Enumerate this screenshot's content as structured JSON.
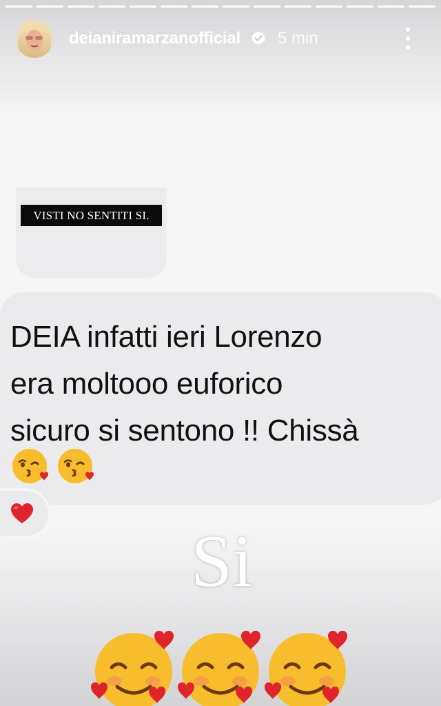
{
  "progress": {
    "segments": 14,
    "current": 14
  },
  "header": {
    "username": "deianiramarzanofficial",
    "time": "5 min",
    "avatar_icon": "avatar-photo",
    "verified_icon": "verified-badge-icon",
    "more_icon": "more-vertical-icon"
  },
  "quote": {
    "label": "VISTI NO SENTITI SI."
  },
  "message": {
    "lines": [
      "DEIA infatti ieri Lorenzo",
      "era moltooo euforico",
      "sicuro si sentono !! Chissà"
    ],
    "emoji": "kissing-face-with-heart-icon",
    "emoji_count": 2,
    "reaction": "red-heart-icon"
  },
  "overlay": {
    "text": "Si",
    "emoji": "smiling-face-with-hearts-icon",
    "emoji_count": 3
  },
  "colors": {
    "background": "#f6f6f7",
    "bubble": "#ebebed",
    "label_bg": "#0b0b0b",
    "heart": "#e0242c",
    "emoji_yellow": "#f7bd2c"
  }
}
